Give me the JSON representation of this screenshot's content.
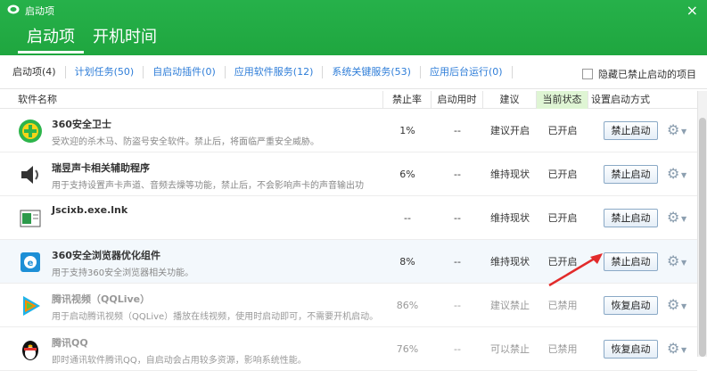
{
  "window": {
    "title": "启动项",
    "close_glyph": "×"
  },
  "tabs": [
    {
      "label": "启动项"
    },
    {
      "label": "开机时间"
    }
  ],
  "filters": [
    {
      "label": "启动项(4)"
    },
    {
      "label": "计划任务(50)"
    },
    {
      "label": "自启动插件(0)"
    },
    {
      "label": "应用软件服务(12)"
    },
    {
      "label": "系统关键服务(53)"
    },
    {
      "label": "应用后台运行(0)"
    }
  ],
  "hide_disabled": {
    "label": "隐藏已禁止启动的项目",
    "checked": false
  },
  "columns": {
    "name": "软件名称",
    "ban_rate": "禁止率",
    "boot_time": "启动用时",
    "advice": "建议",
    "status": "当前状态",
    "setting": "设置启动方式"
  },
  "rows": [
    {
      "name": "360安全卫士",
      "desc": "受欢迎的杀木马、防盗号安全软件。禁止后，将面临严重安全威胁。",
      "ban_rate": "1%",
      "boot_time": "--",
      "advice": "建议开启",
      "status": "已开启",
      "action": "禁止启动",
      "icon": "360-shield-icon",
      "enabled": true
    },
    {
      "name": "瑞昱声卡相关辅助程序",
      "desc": "用于支持设置声卡声道、音频去燥等功能，禁止后，不会影响声卡的声音输出功",
      "ban_rate": "6%",
      "boot_time": "--",
      "advice": "维持现状",
      "status": "已开启",
      "action": "禁止启动",
      "icon": "speaker-icon",
      "enabled": true
    },
    {
      "name": "Jscixb.exe.lnk",
      "desc": "",
      "ban_rate": "--",
      "boot_time": "--",
      "advice": "维持现状",
      "status": "已开启",
      "action": "禁止启动",
      "icon": "shortcut-window-icon",
      "enabled": true
    },
    {
      "name": "360安全浏览器优化组件",
      "desc": "用于支持360安全浏览器相关功能。",
      "ban_rate": "8%",
      "boot_time": "--",
      "advice": "维持现状",
      "status": "已开启",
      "action": "禁止启动",
      "icon": "browser-icon",
      "enabled": true
    },
    {
      "name": "腾讯视频（QQLive）",
      "desc": "用于启动腾讯视频（QQLive）播放在线视频，使用时启动即可，不需要开机启动。",
      "ban_rate": "86%",
      "boot_time": "--",
      "advice": "建议禁止",
      "status": "已禁用",
      "action": "恢复启动",
      "icon": "tencent-video-icon",
      "enabled": false
    },
    {
      "name": "腾讯QQ",
      "desc": "即时通讯软件腾讯QQ，自启动会占用较多资源，影响系统性能。",
      "ban_rate": "76%",
      "boot_time": "--",
      "advice": "可以禁止",
      "status": "已禁用",
      "action": "恢复启动",
      "icon": "qq-penguin-icon",
      "enabled": false
    }
  ],
  "colors": {
    "brand_green": "#1fa63f",
    "link_blue": "#2e7dd8",
    "status_header_bg": "#dff5d4",
    "annotation_red": "#e22b2b"
  }
}
